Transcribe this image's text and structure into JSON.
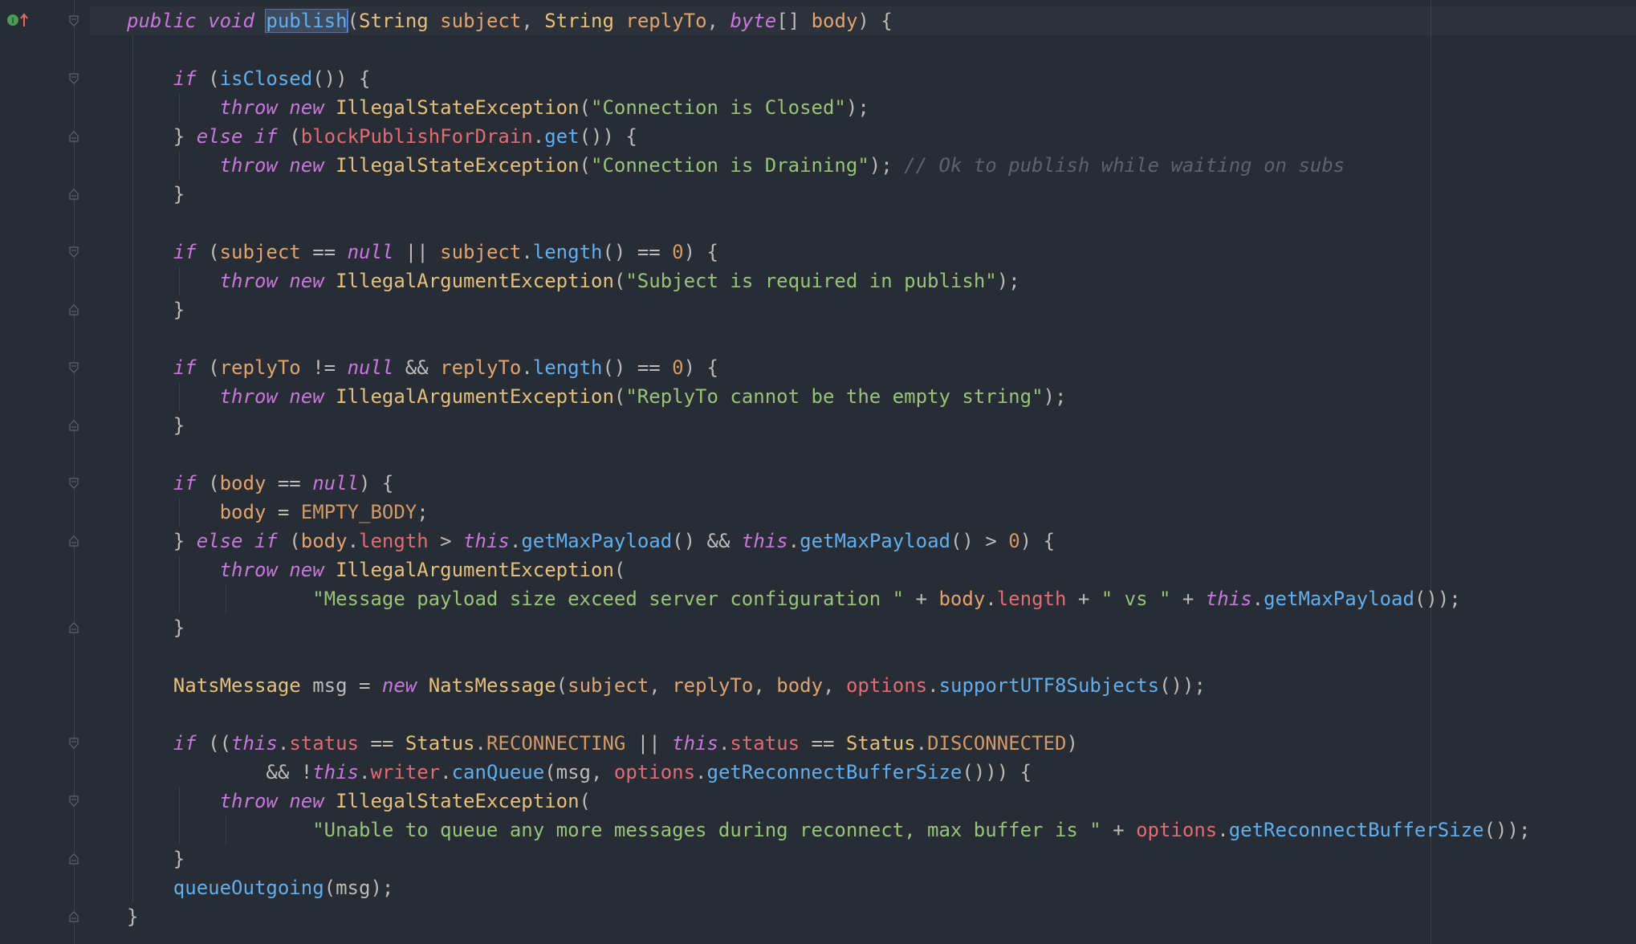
{
  "editor": {
    "colors": {
      "background": "#282c34",
      "keyword": "#c678dd",
      "type": "#e5c07b",
      "parameter": "#e0a46f",
      "method": "#61afef",
      "field": "#e06c75",
      "string": "#98c379",
      "number": "#d19a66",
      "comment": "#5c6370"
    },
    "gutter_icon": "override-method-icon",
    "lines": [
      [
        {
          "c": "kw",
          "t": "public"
        },
        {
          "c": "pl",
          "t": " "
        },
        {
          "c": "kw",
          "t": "void"
        },
        {
          "c": "pl",
          "t": " "
        },
        {
          "c": "fn hl",
          "t": "publish"
        },
        {
          "c": "caret",
          "t": ""
        },
        {
          "c": "pl",
          "t": "("
        },
        {
          "c": "ty",
          "t": "String"
        },
        {
          "c": "pl",
          "t": " "
        },
        {
          "c": "pa",
          "t": "subject"
        },
        {
          "c": "pl",
          "t": ", "
        },
        {
          "c": "ty",
          "t": "String"
        },
        {
          "c": "pl",
          "t": " "
        },
        {
          "c": "pa",
          "t": "replyTo"
        },
        {
          "c": "pl",
          "t": ", "
        },
        {
          "c": "kw",
          "t": "byte"
        },
        {
          "c": "pl",
          "t": "[] "
        },
        {
          "c": "pa",
          "t": "body"
        },
        {
          "c": "pl",
          "t": ") {"
        }
      ],
      [],
      [
        {
          "c": "pl",
          "t": "    "
        },
        {
          "c": "kw",
          "t": "if"
        },
        {
          "c": "pl",
          "t": " ("
        },
        {
          "c": "fn",
          "t": "isClosed"
        },
        {
          "c": "pl",
          "t": "()) {"
        }
      ],
      [
        {
          "c": "pl",
          "t": "        "
        },
        {
          "c": "kw",
          "t": "throw"
        },
        {
          "c": "pl",
          "t": " "
        },
        {
          "c": "kw",
          "t": "new"
        },
        {
          "c": "pl",
          "t": " "
        },
        {
          "c": "ty",
          "t": "IllegalStateException"
        },
        {
          "c": "pl",
          "t": "("
        },
        {
          "c": "st",
          "t": "\"Connection is Closed\""
        },
        {
          "c": "pl",
          "t": ");"
        }
      ],
      [
        {
          "c": "pl",
          "t": "    } "
        },
        {
          "c": "kw",
          "t": "else"
        },
        {
          "c": "pl",
          "t": " "
        },
        {
          "c": "kw",
          "t": "if"
        },
        {
          "c": "pl",
          "t": " ("
        },
        {
          "c": "fd",
          "t": "blockPublishForDrain"
        },
        {
          "c": "pl",
          "t": "."
        },
        {
          "c": "fn",
          "t": "get"
        },
        {
          "c": "pl",
          "t": "()) {"
        }
      ],
      [
        {
          "c": "pl",
          "t": "        "
        },
        {
          "c": "kw",
          "t": "throw"
        },
        {
          "c": "pl",
          "t": " "
        },
        {
          "c": "kw",
          "t": "new"
        },
        {
          "c": "pl",
          "t": " "
        },
        {
          "c": "ty",
          "t": "IllegalStateException"
        },
        {
          "c": "pl",
          "t": "("
        },
        {
          "c": "st",
          "t": "\"Connection is Draining\""
        },
        {
          "c": "pl",
          "t": "); "
        },
        {
          "c": "cm",
          "t": "// Ok to publish while waiting on subs"
        }
      ],
      [
        {
          "c": "pl",
          "t": "    }"
        }
      ],
      [],
      [
        {
          "c": "pl",
          "t": "    "
        },
        {
          "c": "kw",
          "t": "if"
        },
        {
          "c": "pl",
          "t": " ("
        },
        {
          "c": "pa",
          "t": "subject"
        },
        {
          "c": "pl",
          "t": " == "
        },
        {
          "c": "kw",
          "t": "null"
        },
        {
          "c": "pl",
          "t": " || "
        },
        {
          "c": "pa",
          "t": "subject"
        },
        {
          "c": "pl",
          "t": "."
        },
        {
          "c": "fn",
          "t": "length"
        },
        {
          "c": "pl",
          "t": "() == "
        },
        {
          "c": "nu",
          "t": "0"
        },
        {
          "c": "pl",
          "t": ") {"
        }
      ],
      [
        {
          "c": "pl",
          "t": "        "
        },
        {
          "c": "kw",
          "t": "throw"
        },
        {
          "c": "pl",
          "t": " "
        },
        {
          "c": "kw",
          "t": "new"
        },
        {
          "c": "pl",
          "t": " "
        },
        {
          "c": "ty",
          "t": "IllegalArgumentException"
        },
        {
          "c": "pl",
          "t": "("
        },
        {
          "c": "st",
          "t": "\"Subject is required in publish\""
        },
        {
          "c": "pl",
          "t": ");"
        }
      ],
      [
        {
          "c": "pl",
          "t": "    }"
        }
      ],
      [],
      [
        {
          "c": "pl",
          "t": "    "
        },
        {
          "c": "kw",
          "t": "if"
        },
        {
          "c": "pl",
          "t": " ("
        },
        {
          "c": "pa",
          "t": "replyTo"
        },
        {
          "c": "pl",
          "t": " != "
        },
        {
          "c": "kw",
          "t": "null"
        },
        {
          "c": "pl",
          "t": " && "
        },
        {
          "c": "pa",
          "t": "replyTo"
        },
        {
          "c": "pl",
          "t": "."
        },
        {
          "c": "fn",
          "t": "length"
        },
        {
          "c": "pl",
          "t": "() == "
        },
        {
          "c": "nu",
          "t": "0"
        },
        {
          "c": "pl",
          "t": ") {"
        }
      ],
      [
        {
          "c": "pl",
          "t": "        "
        },
        {
          "c": "kw",
          "t": "throw"
        },
        {
          "c": "pl",
          "t": " "
        },
        {
          "c": "kw",
          "t": "new"
        },
        {
          "c": "pl",
          "t": " "
        },
        {
          "c": "ty",
          "t": "IllegalArgumentException"
        },
        {
          "c": "pl",
          "t": "("
        },
        {
          "c": "st",
          "t": "\"ReplyTo cannot be the empty string\""
        },
        {
          "c": "pl",
          "t": ");"
        }
      ],
      [
        {
          "c": "pl",
          "t": "    }"
        }
      ],
      [],
      [
        {
          "c": "pl",
          "t": "    "
        },
        {
          "c": "kw",
          "t": "if"
        },
        {
          "c": "pl",
          "t": " ("
        },
        {
          "c": "pa",
          "t": "body"
        },
        {
          "c": "pl",
          "t": " == "
        },
        {
          "c": "kw",
          "t": "null"
        },
        {
          "c": "pl",
          "t": ") {"
        }
      ],
      [
        {
          "c": "pl",
          "t": "        "
        },
        {
          "c": "pa",
          "t": "body"
        },
        {
          "c": "pl",
          "t": " = "
        },
        {
          "c": "nu",
          "t": "EMPTY_BODY"
        },
        {
          "c": "pl",
          "t": ";"
        }
      ],
      [
        {
          "c": "pl",
          "t": "    } "
        },
        {
          "c": "kw",
          "t": "else"
        },
        {
          "c": "pl",
          "t": " "
        },
        {
          "c": "kw",
          "t": "if"
        },
        {
          "c": "pl",
          "t": " ("
        },
        {
          "c": "pa",
          "t": "body"
        },
        {
          "c": "pl",
          "t": "."
        },
        {
          "c": "fd",
          "t": "length"
        },
        {
          "c": "pl",
          "t": " > "
        },
        {
          "c": "kw",
          "t": "this"
        },
        {
          "c": "pl",
          "t": "."
        },
        {
          "c": "fn",
          "t": "getMaxPayload"
        },
        {
          "c": "pl",
          "t": "() && "
        },
        {
          "c": "kw",
          "t": "this"
        },
        {
          "c": "pl",
          "t": "."
        },
        {
          "c": "fn",
          "t": "getMaxPayload"
        },
        {
          "c": "pl",
          "t": "() > "
        },
        {
          "c": "nu",
          "t": "0"
        },
        {
          "c": "pl",
          "t": ") {"
        }
      ],
      [
        {
          "c": "pl",
          "t": "        "
        },
        {
          "c": "kw",
          "t": "throw"
        },
        {
          "c": "pl",
          "t": " "
        },
        {
          "c": "kw",
          "t": "new"
        },
        {
          "c": "pl",
          "t": " "
        },
        {
          "c": "ty",
          "t": "IllegalArgumentException"
        },
        {
          "c": "pl",
          "t": "("
        }
      ],
      [
        {
          "c": "pl",
          "t": "                "
        },
        {
          "c": "st",
          "t": "\"Message payload size exceed server configuration \""
        },
        {
          "c": "pl",
          "t": " + "
        },
        {
          "c": "pa",
          "t": "body"
        },
        {
          "c": "pl",
          "t": "."
        },
        {
          "c": "fd",
          "t": "length"
        },
        {
          "c": "pl",
          "t": " + "
        },
        {
          "c": "st",
          "t": "\" vs \""
        },
        {
          "c": "pl",
          "t": " + "
        },
        {
          "c": "kw",
          "t": "this"
        },
        {
          "c": "pl",
          "t": "."
        },
        {
          "c": "fn",
          "t": "getMaxPayload"
        },
        {
          "c": "pl",
          "t": "());"
        }
      ],
      [
        {
          "c": "pl",
          "t": "    }"
        }
      ],
      [],
      [
        {
          "c": "pl",
          "t": "    "
        },
        {
          "c": "ty",
          "t": "NatsMessage"
        },
        {
          "c": "pl",
          "t": " msg = "
        },
        {
          "c": "kw",
          "t": "new"
        },
        {
          "c": "pl",
          "t": " "
        },
        {
          "c": "ty",
          "t": "NatsMessage"
        },
        {
          "c": "pl",
          "t": "("
        },
        {
          "c": "pa",
          "t": "subject"
        },
        {
          "c": "pl",
          "t": ", "
        },
        {
          "c": "pa",
          "t": "replyTo"
        },
        {
          "c": "pl",
          "t": ", "
        },
        {
          "c": "pa",
          "t": "body"
        },
        {
          "c": "pl",
          "t": ", "
        },
        {
          "c": "fd",
          "t": "options"
        },
        {
          "c": "pl",
          "t": "."
        },
        {
          "c": "fn",
          "t": "supportUTF8Subjects"
        },
        {
          "c": "pl",
          "t": "());"
        }
      ],
      [],
      [
        {
          "c": "pl",
          "t": "    "
        },
        {
          "c": "kw",
          "t": "if"
        },
        {
          "c": "pl",
          "t": " (("
        },
        {
          "c": "kw",
          "t": "this"
        },
        {
          "c": "pl",
          "t": "."
        },
        {
          "c": "fd",
          "t": "status"
        },
        {
          "c": "pl",
          "t": " == "
        },
        {
          "c": "ty",
          "t": "Status"
        },
        {
          "c": "pl",
          "t": "."
        },
        {
          "c": "nu",
          "t": "RECONNECTING"
        },
        {
          "c": "pl",
          "t": " || "
        },
        {
          "c": "kw",
          "t": "this"
        },
        {
          "c": "pl",
          "t": "."
        },
        {
          "c": "fd",
          "t": "status"
        },
        {
          "c": "pl",
          "t": " == "
        },
        {
          "c": "ty",
          "t": "Status"
        },
        {
          "c": "pl",
          "t": "."
        },
        {
          "c": "nu",
          "t": "DISCONNECTED"
        },
        {
          "c": "pl",
          "t": ")"
        }
      ],
      [
        {
          "c": "pl",
          "t": "            && !"
        },
        {
          "c": "kw",
          "t": "this"
        },
        {
          "c": "pl",
          "t": "."
        },
        {
          "c": "fd",
          "t": "writer"
        },
        {
          "c": "pl",
          "t": "."
        },
        {
          "c": "fn",
          "t": "canQueue"
        },
        {
          "c": "pl",
          "t": "(msg, "
        },
        {
          "c": "fd",
          "t": "options"
        },
        {
          "c": "pl",
          "t": "."
        },
        {
          "c": "fn",
          "t": "getReconnectBufferSize"
        },
        {
          "c": "pl",
          "t": "())) {"
        }
      ],
      [
        {
          "c": "pl",
          "t": "        "
        },
        {
          "c": "kw",
          "t": "throw"
        },
        {
          "c": "pl",
          "t": " "
        },
        {
          "c": "kw",
          "t": "new"
        },
        {
          "c": "pl",
          "t": " "
        },
        {
          "c": "ty",
          "t": "IllegalStateException"
        },
        {
          "c": "pl",
          "t": "("
        }
      ],
      [
        {
          "c": "pl",
          "t": "                "
        },
        {
          "c": "st",
          "t": "\"Unable to queue any more messages during reconnect, max buffer is \""
        },
        {
          "c": "pl",
          "t": " + "
        },
        {
          "c": "fd",
          "t": "options"
        },
        {
          "c": "pl",
          "t": "."
        },
        {
          "c": "fn",
          "t": "getReconnectBufferSize"
        },
        {
          "c": "pl",
          "t": "());"
        }
      ],
      [
        {
          "c": "pl",
          "t": "    }"
        }
      ],
      [
        {
          "c": "pl",
          "t": "    "
        },
        {
          "c": "fn",
          "t": "queueOutgoing"
        },
        {
          "c": "pl",
          "t": "(msg);"
        }
      ],
      [
        {
          "c": "pl",
          "t": "}"
        }
      ]
    ]
  }
}
